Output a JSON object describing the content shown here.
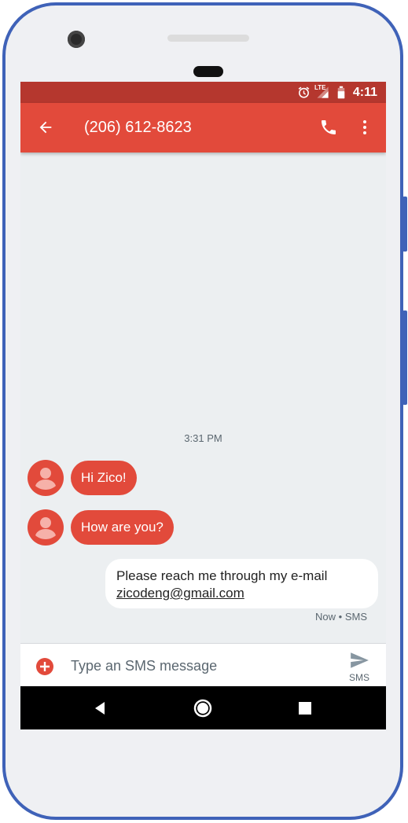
{
  "status_bar": {
    "time": "4:11",
    "network": "LTE"
  },
  "app_bar": {
    "title": "(206) 612-8623"
  },
  "conversation": {
    "timestamp": "3:31 PM",
    "incoming": [
      {
        "text": "Hi Zico!"
      },
      {
        "text": "How are you?"
      }
    ],
    "outgoing": {
      "line1": "Please reach me through my e-mail",
      "email": "zicodeng@gmail.com",
      "meta": "Now • SMS"
    }
  },
  "compose": {
    "placeholder": "Type an SMS message",
    "send_label": "SMS"
  },
  "colors": {
    "primary": "#e24a3b",
    "status_bar": "#b5372e",
    "frame": "#3f62b8",
    "background": "#eceff1"
  }
}
